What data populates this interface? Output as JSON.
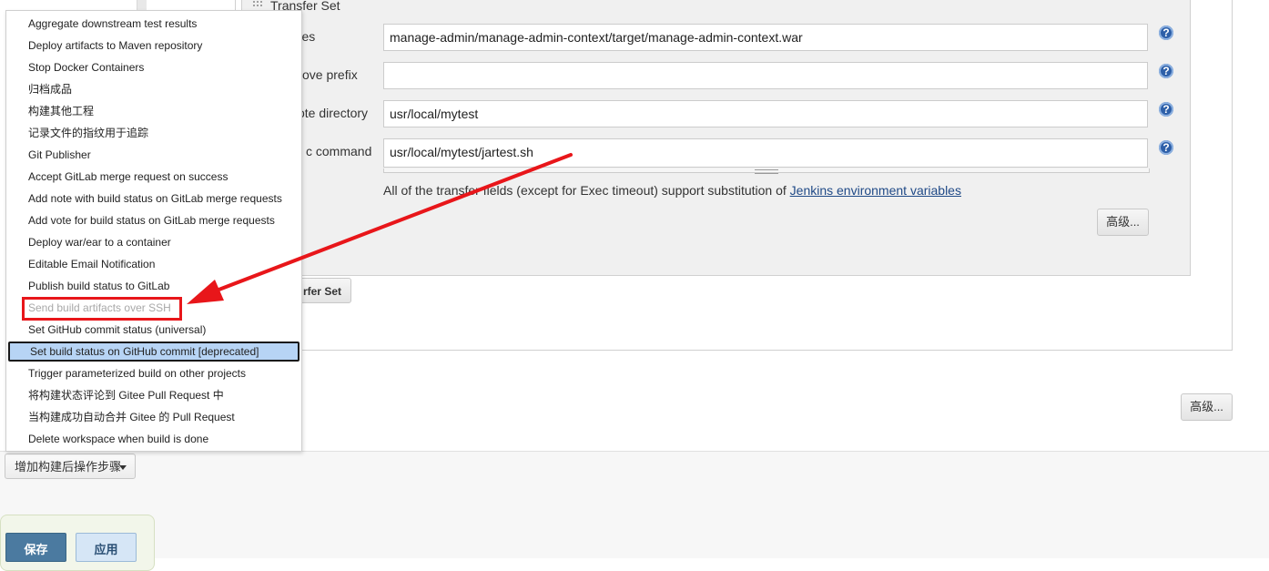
{
  "transfer_set": {
    "title": "Transfer Set",
    "fields": [
      {
        "label": "Source files",
        "visible_label": "rce files",
        "value": "manage-admin/manage-admin-context/target/manage-admin-context.war"
      },
      {
        "label": "Remove prefix",
        "visible_label": "ove prefix",
        "value": ""
      },
      {
        "label": "Remote directory",
        "visible_label": "ote directory",
        "value": "usr/local/mytest"
      },
      {
        "label": "Exec command",
        "visible_label": "c command",
        "value": "usr/local/mytest/jartest.sh"
      }
    ],
    "note_text": "All of the transfer fields (except for Exec timeout) support substitution of ",
    "note_link": "Jenkins environment variables",
    "advanced_label": "高级...",
    "add_transfer_set_label": "rfer Set"
  },
  "outer": {
    "advanced_label": "高级..."
  },
  "help_icon": {
    "glyph": "?",
    "icon": "help-icon"
  },
  "dropdown": {
    "items": [
      {
        "label": "Aggregate downstream test results"
      },
      {
        "label": "Deploy artifacts to Maven repository"
      },
      {
        "label": "Stop Docker Containers"
      },
      {
        "label": "归档成品"
      },
      {
        "label": "构建其他工程"
      },
      {
        "label": "记录文件的指纹用于追踪"
      },
      {
        "label": "Git Publisher"
      },
      {
        "label": "Accept GitLab merge request on success"
      },
      {
        "label": "Add note with build status on GitLab merge requests"
      },
      {
        "label": "Add vote for build status on GitLab merge requests"
      },
      {
        "label": "Deploy war/ear to a container"
      },
      {
        "label": "Editable Email Notification"
      },
      {
        "label": "Publish build status to GitLab"
      },
      {
        "label": "Send build artifacts over SSH",
        "state": "disabled"
      },
      {
        "label": "Set GitHub commit status (universal)"
      },
      {
        "label": "Set build status on GitHub commit [deprecated]",
        "state": "selected"
      },
      {
        "label": "Trigger parameterized build on other projects"
      },
      {
        "label": "将构建状态评论到 Gitee Pull Request 中"
      },
      {
        "label": "当构建成功自动合并 Gitee 的 Pull Request"
      },
      {
        "label": "Delete workspace when build is done"
      }
    ]
  },
  "footer": {
    "add_step_label": "增加构建后操作步骤",
    "save_label": "保存",
    "apply_label": "应用"
  },
  "annotation": {
    "color": "#e8161a"
  }
}
